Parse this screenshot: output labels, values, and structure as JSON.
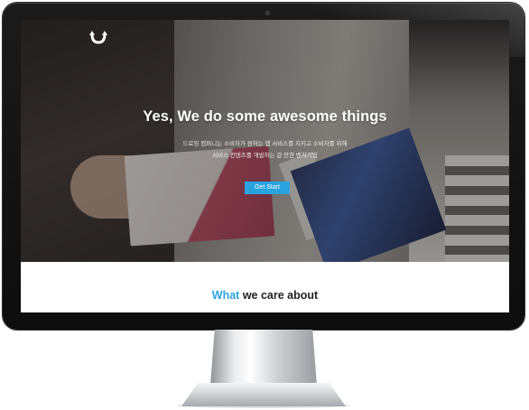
{
  "hero": {
    "title": "Yes, We do some awesome things",
    "subtitle_line1": "드로잉 컴퍼니는 소비자가 원하는 앱 서비스를 지키고 소비자를 위해",
    "subtitle_line2": "서비스 컨텐츠를 개발하는 갈 만한 벤처기업",
    "cta_label": "Get Start"
  },
  "section": {
    "title_accent": "What",
    "title_rest": " we care about"
  },
  "colors": {
    "accent": "#29a3e0",
    "bezel": "#111111",
    "heading": "#222222"
  },
  "icons": {
    "logo": "curved-arrow-logo-icon",
    "camera": "webcam-dot-icon"
  }
}
